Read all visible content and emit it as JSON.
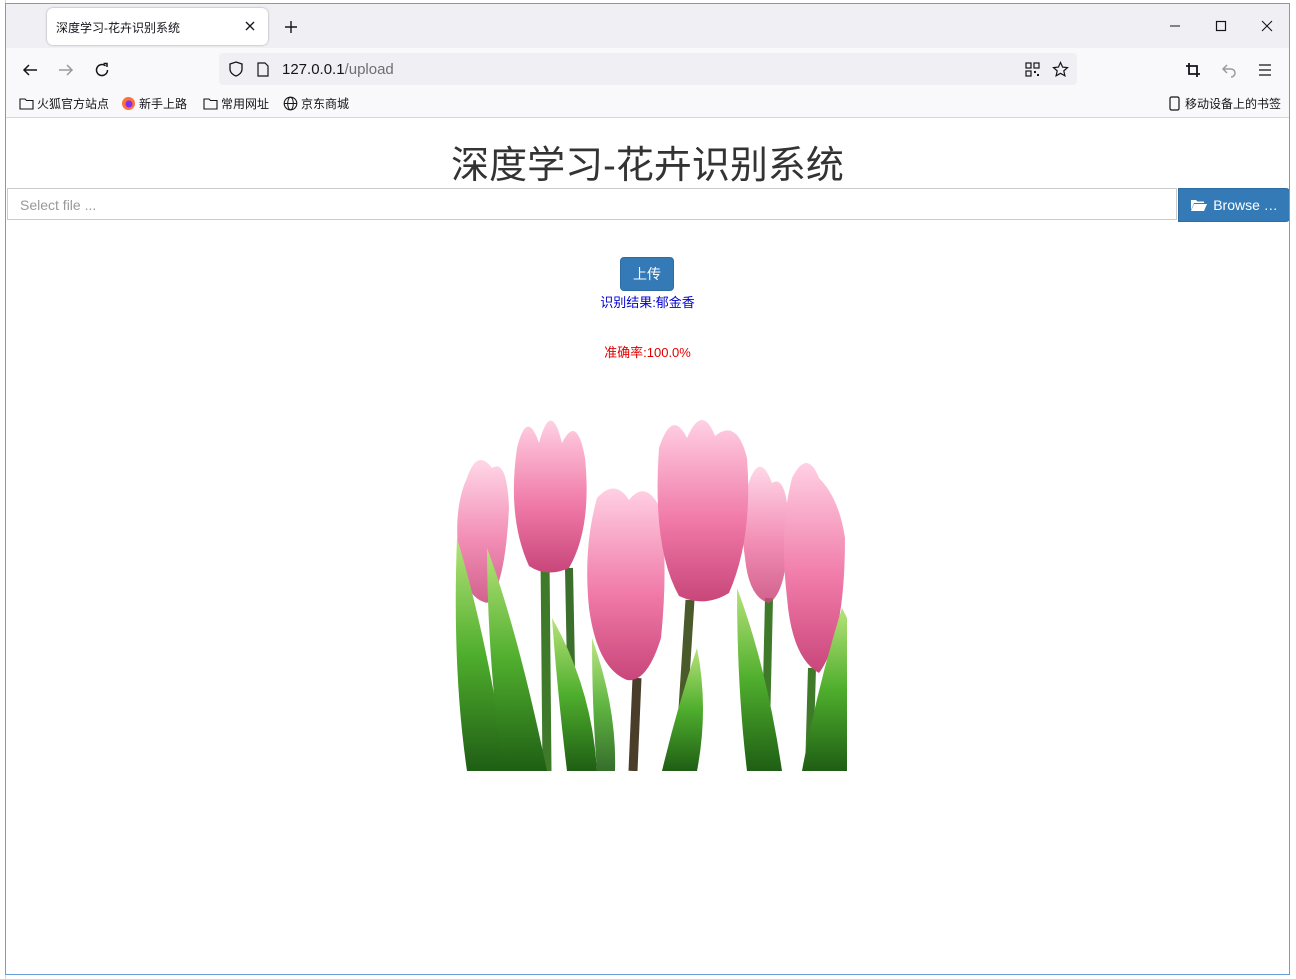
{
  "browser": {
    "tab_title": "深度学习-花卉识别系统",
    "url_host": "127.0.0.1",
    "url_path": "/upload",
    "bookmarks": [
      {
        "label": "火狐官方站点",
        "icon": "folder-icon"
      },
      {
        "label": "新手上路",
        "icon": "firefox-icon"
      },
      {
        "label": "常用网址",
        "icon": "folder-icon"
      },
      {
        "label": "京东商城",
        "icon": "globe-icon"
      }
    ],
    "mobile_bookmarks": "移动设备上的书签"
  },
  "page": {
    "title": "深度学习-花卉识别系统",
    "file_placeholder": "Select file ...",
    "browse_label": "Browse …",
    "upload_label": "上传",
    "result_text": "识别结果:郁金香",
    "accuracy_text": "准确率:100.0%"
  },
  "colors": {
    "primary_button": "#337ab7",
    "result_text": "#0000cc",
    "accuracy_text": "#e00000"
  }
}
